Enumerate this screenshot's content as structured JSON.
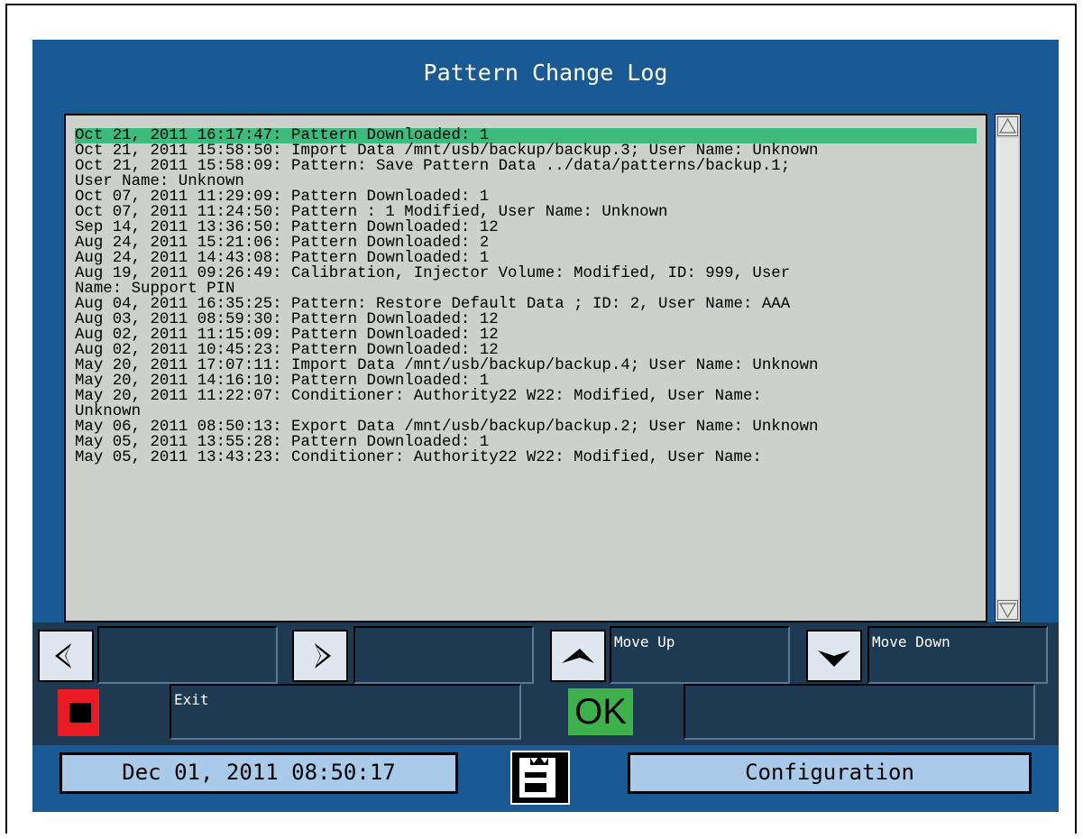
{
  "title": "Pattern Change Log",
  "log_entries": [
    "Oct 21, 2011 16:17:47: Pattern Downloaded: 1",
    "Oct 21, 2011 15:58:50: Import Data /mnt/usb/backup/backup.3; User Name: Unknown",
    "Oct 21, 2011 15:58:09: Pattern: Save Pattern Data ../data/patterns/backup.1;",
    "User Name: Unknown",
    "Oct 07, 2011 11:29:09: Pattern Downloaded: 1",
    "Oct 07, 2011 11:24:50: Pattern : 1 Modified, User Name: Unknown",
    "Sep 14, 2011 13:36:50: Pattern Downloaded: 12",
    "Aug 24, 2011 15:21:06: Pattern Downloaded: 2",
    "Aug 24, 2011 14:43:08: Pattern Downloaded: 1",
    "Aug 19, 2011 09:26:49: Calibration, Injector Volume: Modified, ID: 999, User",
    "Name: Support PIN",
    "Aug 04, 2011 16:35:25: Pattern: Restore Default Data ; ID: 2, User Name: AAA",
    "Aug 03, 2011 08:59:30: Pattern Downloaded: 12",
    "Aug 02, 2011 11:15:09: Pattern Downloaded: 12",
    "Aug 02, 2011 10:45:23: Pattern Downloaded: 12",
    "May 20, 2011 17:07:11: Import Data /mnt/usb/backup/backup.4; User Name: Unknown",
    "May 20, 2011 14:16:10: Pattern Downloaded: 1",
    "May 20, 2011 11:22:07: Conditioner: Authority22 W22: Modified, User Name:",
    "Unknown",
    "May 06, 2011 08:50:13: Export Data /mnt/usb/backup/backup.2; User Name: Unknown",
    "May 05, 2011 13:55:28: Pattern Downloaded: 1",
    "May 05, 2011 13:43:23: Conditioner: Authority22 W22: Modified, User Name:"
  ],
  "controls": {
    "left_field": "",
    "right_field": "",
    "move_up_label": "Move Up",
    "move_down_label": "Move Down",
    "exit_label": "Exit",
    "ok_label": "OK",
    "ok_field": ""
  },
  "footer": {
    "datetime": "Dec 01, 2011 08:50:17",
    "configuration_label": "Configuration"
  },
  "icons": {
    "left": "arrow-left-icon",
    "right": "arrow-right-icon",
    "up": "arrow-up-icon",
    "down": "arrow-down-icon",
    "stop": "stop-icon",
    "logo": "brand-logo-icon"
  },
  "colors": {
    "screen_bg": "#1a5a94",
    "panel_bg": "#cdd0cb",
    "selected_row": "#3dbb7d",
    "stop_red": "#ea1b23",
    "ok_green": "#3db24a",
    "footer_button": "#a9cbe9"
  }
}
